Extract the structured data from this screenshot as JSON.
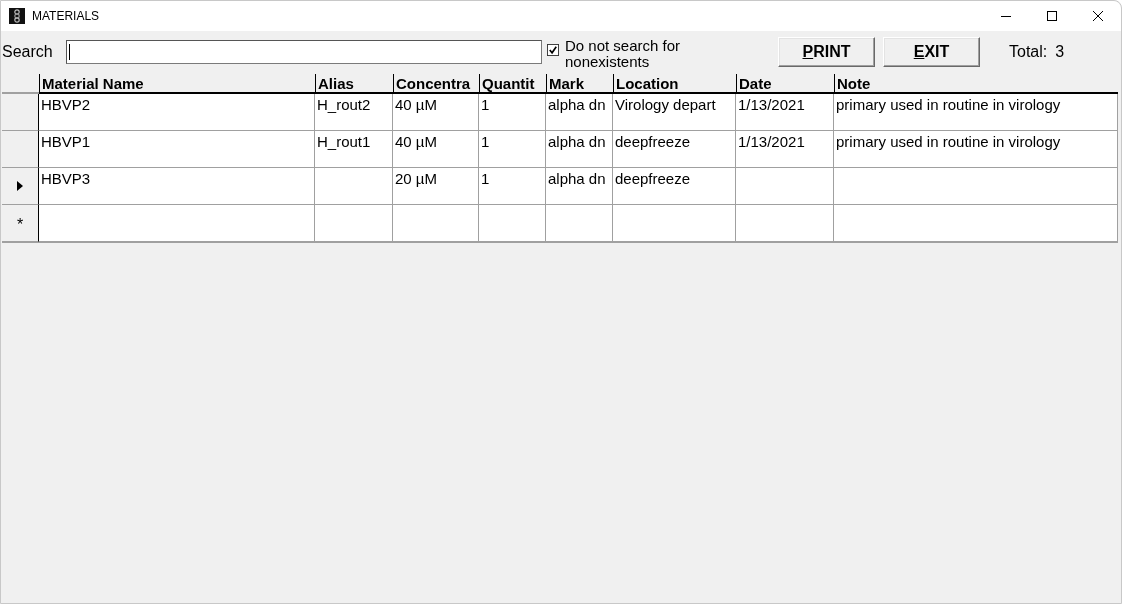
{
  "window": {
    "title": "MATERIALS"
  },
  "search": {
    "label": "Search",
    "focused": true
  },
  "filter": {
    "label": "Do not search for nonexistents",
    "checked": true
  },
  "buttons": [
    {
      "label": "PRINT"
    },
    {
      "label": "EXIT"
    }
  ],
  "total": {
    "label": "Total:",
    "value": "3"
  },
  "table": {
    "columns": [
      "Material Name",
      "Alias",
      "Concentra",
      "Quantit",
      "Mark",
      "Location",
      "Date",
      "Note"
    ],
    "rows": [
      {
        "selected": false,
        "cells": [
          "HBVP2",
          "H_rout2",
          "40 µM",
          "1",
          "alpha dn",
          "Virology depart",
          "1/13/2021",
          "primary used in routine in virology"
        ]
      },
      {
        "selected": false,
        "cells": [
          "HBVP1",
          "H_rout1",
          "40 µM",
          "1",
          "alpha dn",
          "deepfreeze",
          "1/13/2021",
          "primary used in routine in virology"
        ]
      },
      {
        "selected": true,
        "cells": [
          "HBVP3",
          null,
          "20 µM",
          "1",
          "alpha dn",
          "deepfreeze",
          null,
          null
        ]
      }
    ],
    "new_row": {
      "marker": "*"
    }
  }
}
